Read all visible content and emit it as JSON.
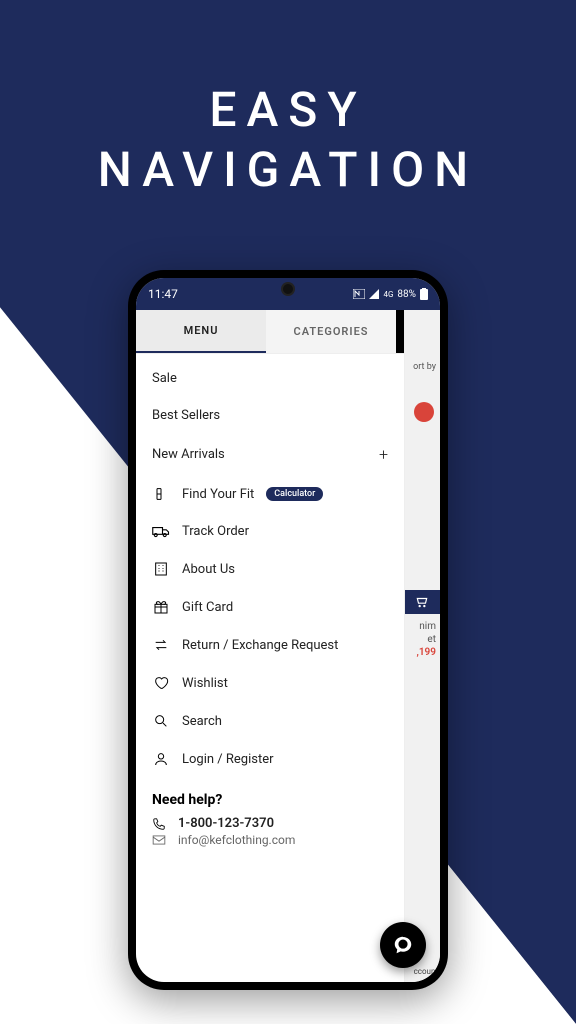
{
  "headline_line1": "EASY",
  "headline_line2": "NAVIGATION",
  "status": {
    "time": "11:47",
    "battery": "88%"
  },
  "tabs": {
    "menu": "MENU",
    "categories": "CATEGORIES"
  },
  "menu": {
    "sale": "Sale",
    "best_sellers": "Best Sellers",
    "new_arrivals": "New Arrivals",
    "find_fit": "Find Your Fit",
    "find_fit_badge": "Calculator",
    "track_order": "Track Order",
    "about": "About Us",
    "gift_card": "Gift Card",
    "return": "Return / Exchange Request",
    "wishlist": "Wishlist",
    "search": "Search",
    "login": "Login / Register"
  },
  "help": {
    "title": "Need help?",
    "phone": "1-800-123-7370",
    "email": "info@kefclothing.com"
  },
  "bg_app": {
    "sort": "ort by",
    "prod_line1": "nim",
    "prod_line2": "et",
    "price": ",199",
    "account": "ccount"
  }
}
